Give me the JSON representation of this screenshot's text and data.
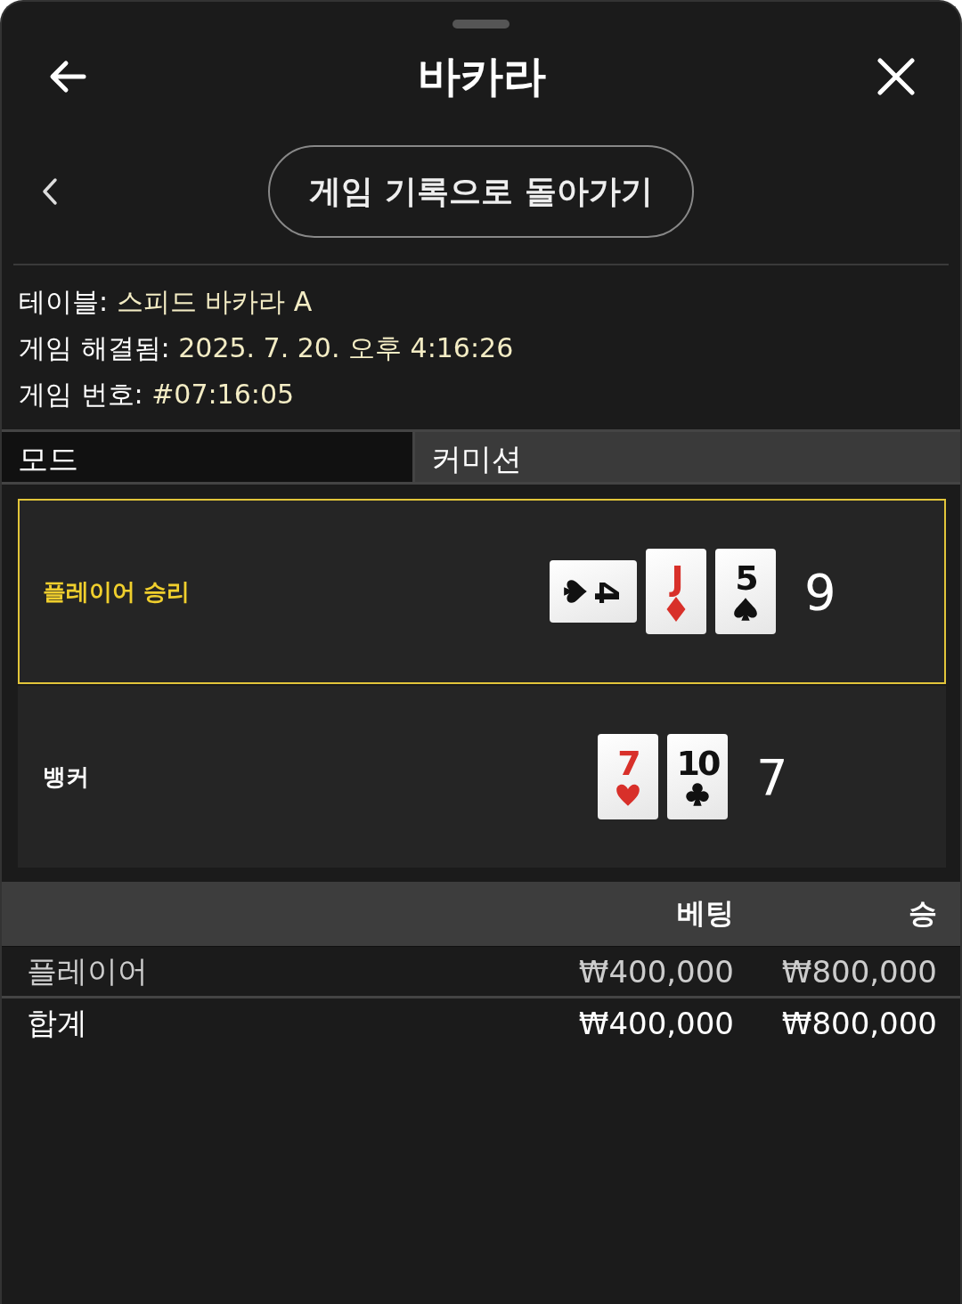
{
  "header": {
    "title": "바카라"
  },
  "back_button": {
    "label": "게임 기록으로 돌아가기"
  },
  "info": [
    {
      "label": "테이블:",
      "value": "스피드 바카라 A"
    },
    {
      "label": "게임 해결됨:",
      "value": "2025. 7. 20. 오후 4:16:26"
    },
    {
      "label": "게임 번호:",
      "value": "#07:16:05"
    }
  ],
  "mode": {
    "label": "모드",
    "value": "커미션"
  },
  "hands": [
    {
      "label": "플레이어 승리",
      "winner": true,
      "total": "9",
      "cards": [
        {
          "rank": "4",
          "kind": "spade",
          "rotated": true
        },
        {
          "rank": "J",
          "kind": "diamond",
          "rotated": false
        },
        {
          "rank": "5",
          "kind": "spade",
          "rotated": false
        }
      ]
    },
    {
      "label": "뱅커",
      "winner": false,
      "total": "7",
      "cards": [
        {
          "rank": "7",
          "kind": "heart",
          "rotated": false
        },
        {
          "rank": "10",
          "kind": "club",
          "rotated": false
        }
      ]
    }
  ],
  "bets": {
    "columns": [
      "베팅",
      "승"
    ],
    "rows": [
      {
        "kind": "bet",
        "label": "플레이어",
        "bet": "₩400,000",
        "win": "₩800,000"
      },
      {
        "kind": "total",
        "label": "합계",
        "bet": "₩400,000",
        "win": "₩800,000"
      }
    ]
  }
}
